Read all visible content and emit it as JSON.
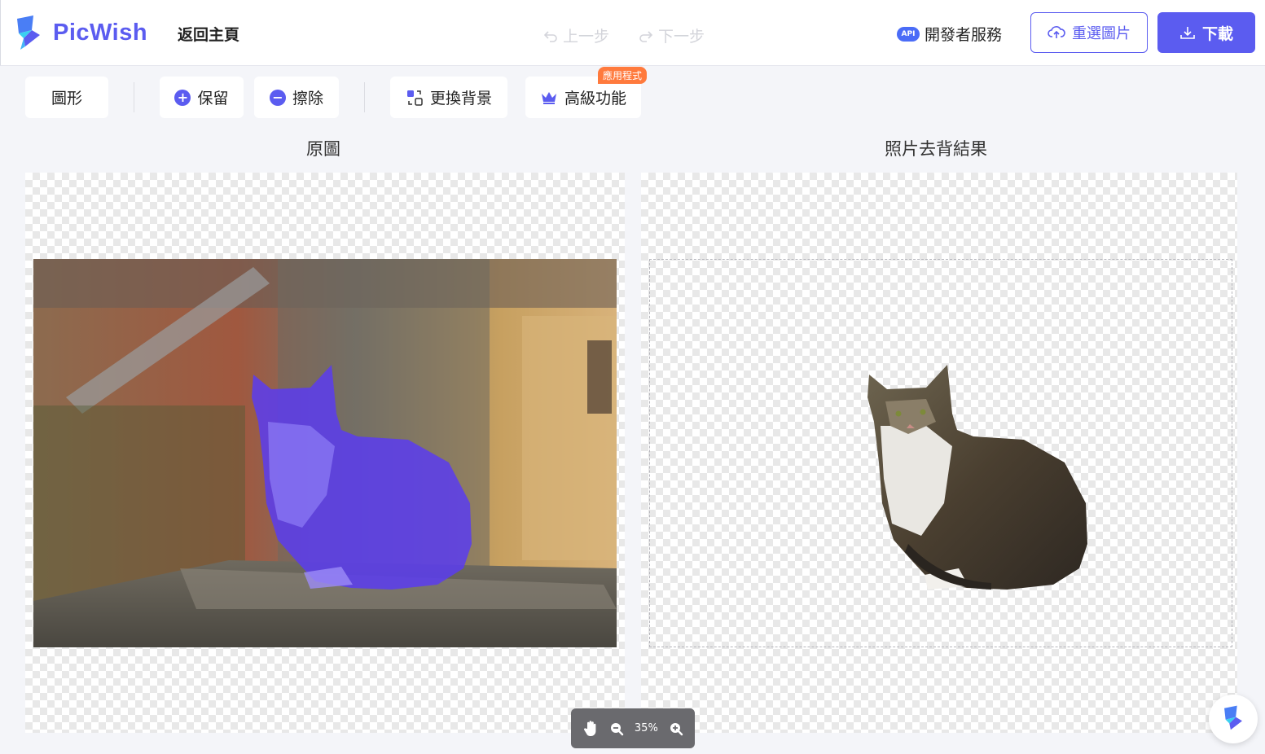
{
  "header": {
    "brand": "PicWish",
    "back_home": "返回主頁",
    "undo": "上一步",
    "redo": "下一步",
    "api_badge": "API",
    "api_link": "開發者服務",
    "reselect": "重選圖片",
    "download": "下載"
  },
  "toolbar": {
    "shape": "圖形",
    "keep": "保留",
    "erase": "擦除",
    "change_bg": "更換背景",
    "advanced": "高級功能",
    "app_tag": "應用程式"
  },
  "panels": {
    "original_title": "原圖",
    "result_title": "照片去背結果"
  },
  "zoom": {
    "level": "35%"
  },
  "colors": {
    "accent": "#5b5cf0",
    "tag": "#ff7a3d",
    "mask": "#5a3cf0"
  }
}
